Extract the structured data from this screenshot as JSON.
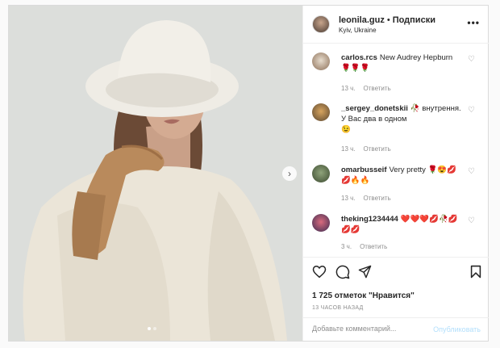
{
  "post": {
    "username": "leonila.guz",
    "separator": "•",
    "follow_label": "Подписки",
    "location": "Kyiv, Ukraine",
    "more_label": "•••",
    "carousel_dots": 2,
    "active_dot": 1,
    "next_label": "›"
  },
  "comments": [
    {
      "user": "carlos.rcs",
      "text": "New Audrey Hepburn",
      "emoji_line": "🌹🌹🌹",
      "time": "13 ч.",
      "reply": "Ответить"
    },
    {
      "user": "_sergey_donetskii",
      "text": "🥀 внутрення. У Вас два в одном",
      "emoji_line": "😉",
      "time": "13 ч.",
      "reply": "Ответить"
    },
    {
      "user": "omarbusseif",
      "text": "Very pretty 🌹😍💋",
      "emoji_line": "💋🔥🔥",
      "time": "13 ч.",
      "reply": "Ответить"
    },
    {
      "user": "theking1234444",
      "text": "❤️❤️❤️💋🥀💋",
      "emoji_line": "💋💋",
      "time": "3 ч.",
      "reply": "Ответить"
    }
  ],
  "actions": {
    "likes": "1 725 отметок \"Нравится\"",
    "time_ago": "13 ЧАСОВ НАЗАД",
    "comment_placeholder": "Добавьте комментарий...",
    "publish_label": "Опубликовать"
  },
  "icons": {
    "like": "heart-icon",
    "comment": "comment-icon",
    "share": "share-icon",
    "save": "bookmark-icon",
    "comment_like": "small-heart-icon"
  },
  "colors": {
    "accent_disabled": "#b2dffc",
    "muted_text": "#8e8e8e",
    "border": "#dbdbdb"
  }
}
